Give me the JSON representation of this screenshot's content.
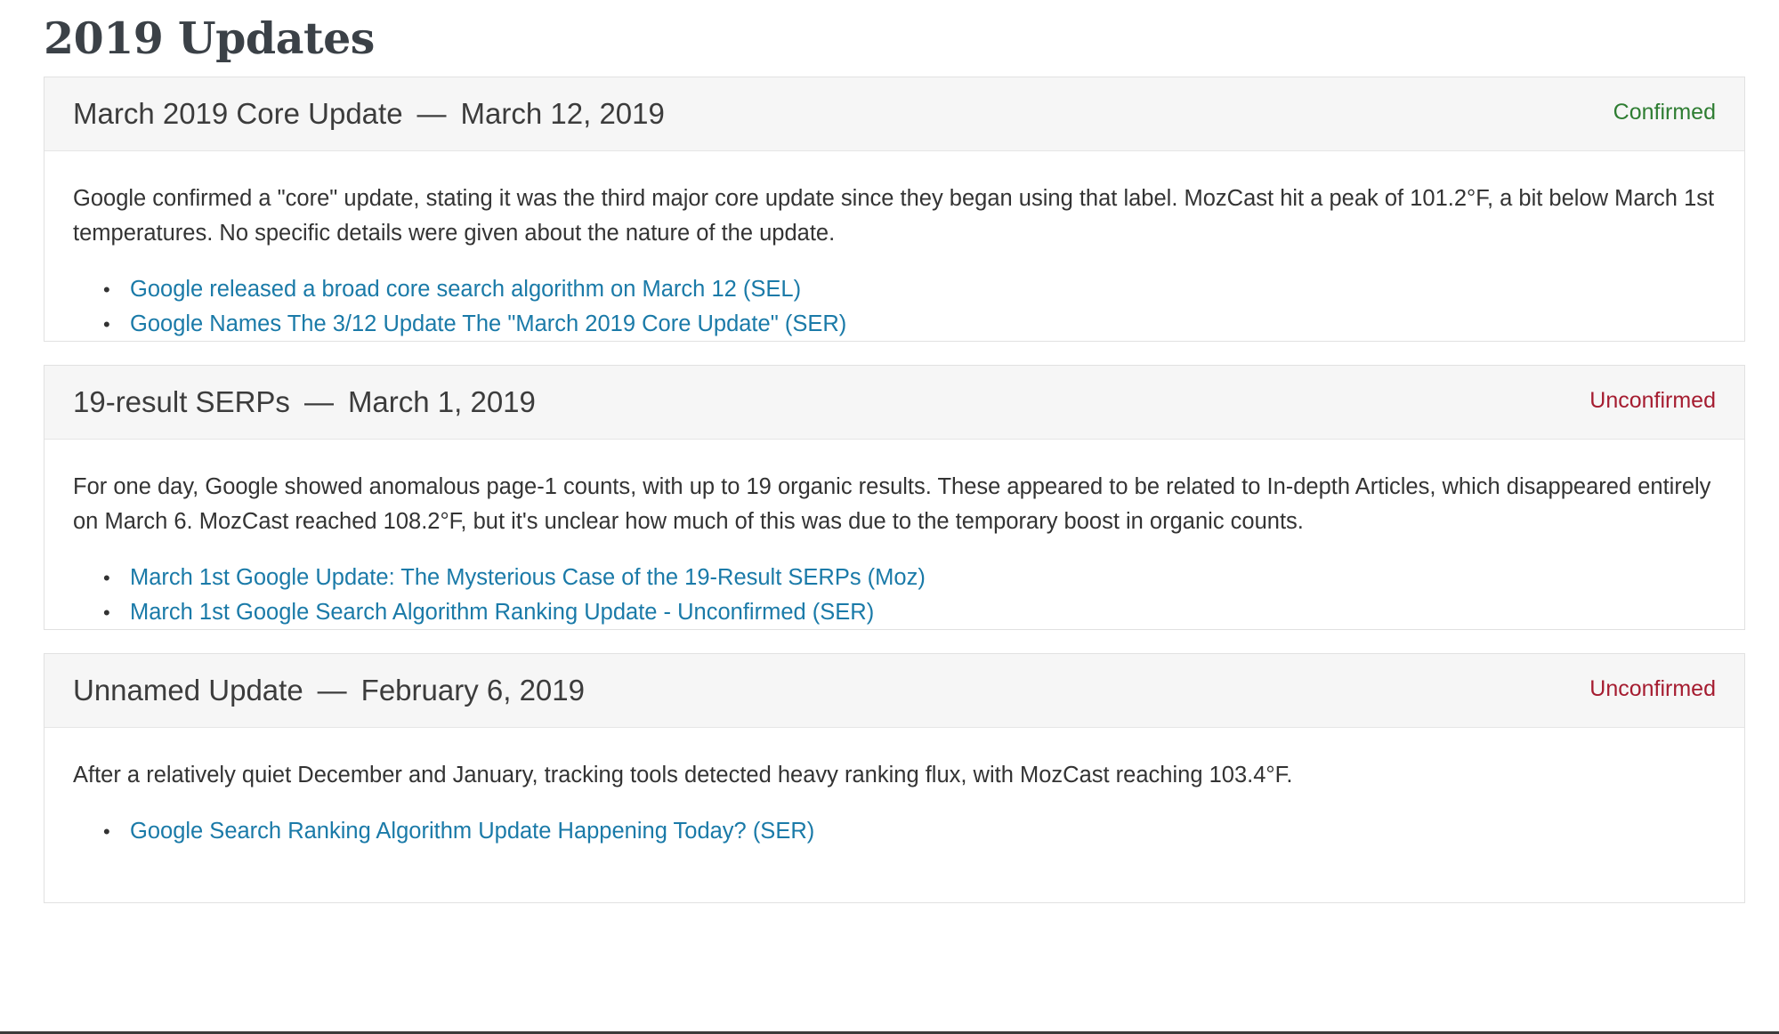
{
  "section": {
    "title": "2019 Updates"
  },
  "updates": [
    {
      "name": "March 2019 Core Update",
      "separator": "—",
      "date": "March 12, 2019",
      "status": "Confirmed",
      "description": "Google confirmed a \"core\" update, stating it was the third major core update since they began using that label. MozCast hit a peak of 101.2°F, a bit below March 1st temperatures. No specific details were given about the nature of the update.",
      "links": [
        "Google released a broad core search algorithm on March 12 (SEL)",
        "Google Names The 3/12 Update The \"March 2019 Core Update\" (SER)"
      ]
    },
    {
      "name": "19-result SERPs",
      "separator": "—",
      "date": "March 1, 2019",
      "status": "Unconfirmed",
      "description": "For one day, Google showed anomalous page-1 counts, with up to 19 organic results. These appeared to be related to In-depth Articles, which disappeared entirely on March 6. MozCast reached 108.2°F, but it's unclear how much of this was due to the temporary boost in organic counts.",
      "links": [
        "March 1st Google Update: The Mysterious Case of the 19-Result SERPs (Moz)",
        "March 1st Google Search Algorithm Ranking Update - Unconfirmed (SER)"
      ]
    },
    {
      "name": "Unnamed Update",
      "separator": "—",
      "date": "February 6, 2019",
      "status": "Unconfirmed",
      "description": "After a relatively quiet December and January, tracking tools detected heavy ranking flux, with MozCast reaching 103.4°F.",
      "links": [
        "Google Search Ranking Algorithm Update Happening Today? (SER)"
      ]
    }
  ],
  "colors": {
    "confirmed": "#2e7d32",
    "unconfirmed": "#a51c30",
    "link": "#1a7aa8"
  }
}
